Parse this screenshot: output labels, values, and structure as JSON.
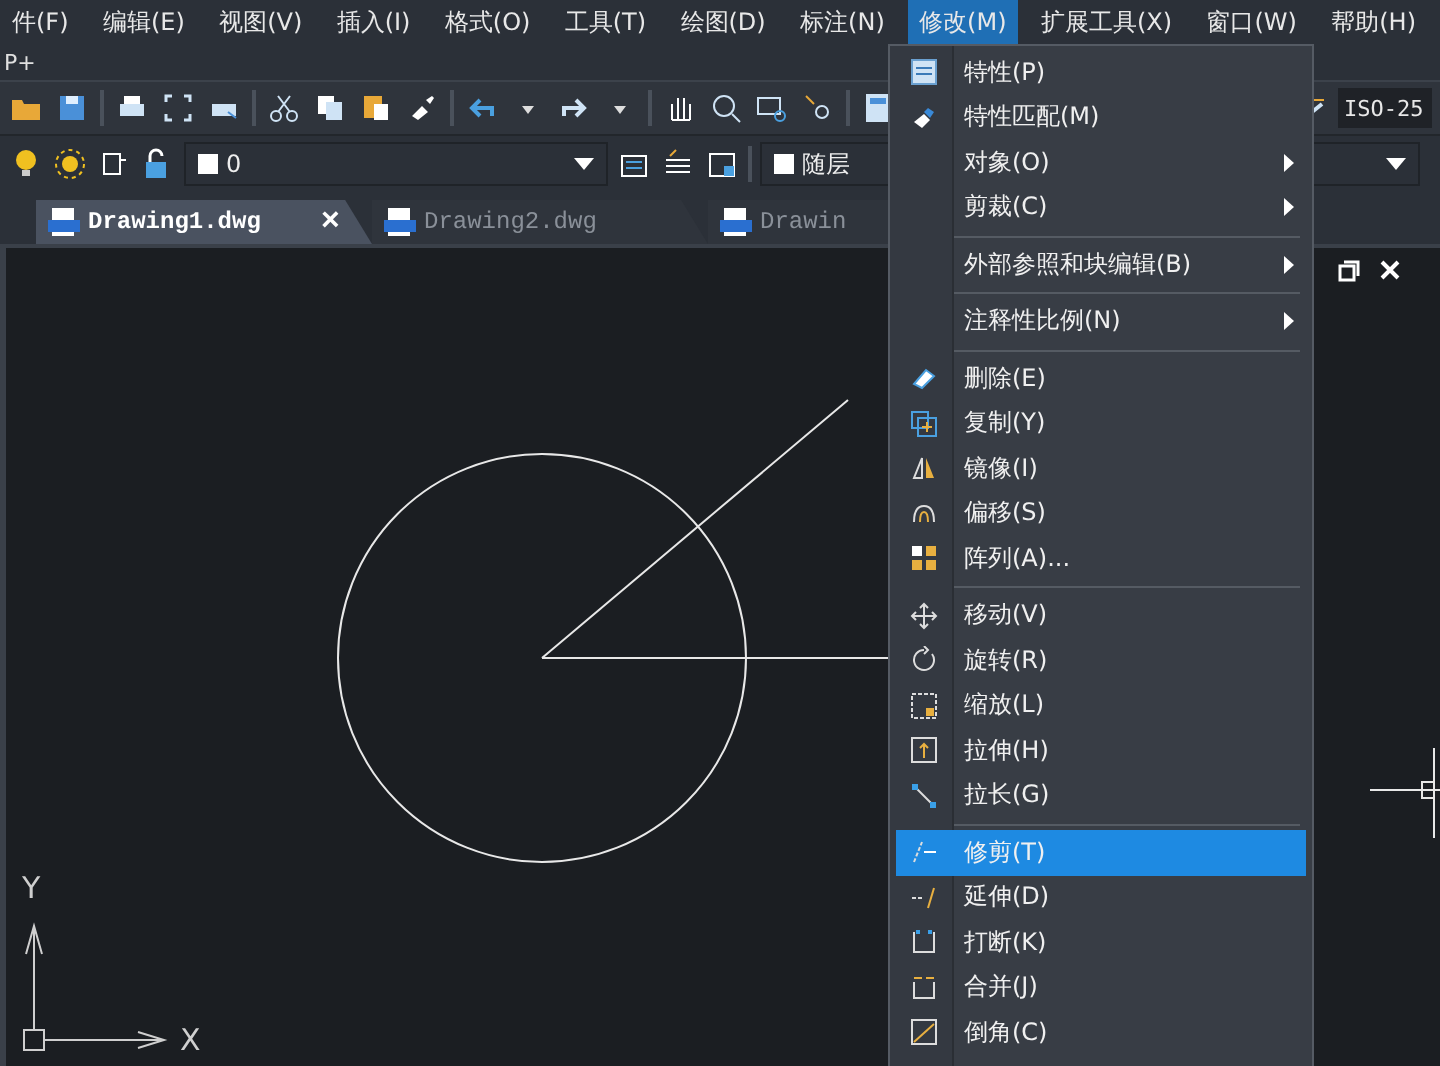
{
  "menubar": [
    {
      "label": "件(F)",
      "selected": false
    },
    {
      "label": "编辑(E)",
      "selected": false
    },
    {
      "label": "视图(V)",
      "selected": false
    },
    {
      "label": "插入(I)",
      "selected": false
    },
    {
      "label": "格式(O)",
      "selected": false
    },
    {
      "label": "工具(T)",
      "selected": false
    },
    {
      "label": "绘图(D)",
      "selected": false
    },
    {
      "label": "标注(N)",
      "selected": false
    },
    {
      "label": "修改(M)",
      "selected": true
    },
    {
      "label": "扩展工具(X)",
      "selected": false
    },
    {
      "label": "窗口(W)",
      "selected": false
    },
    {
      "label": "帮助(H)",
      "selected": false
    }
  ],
  "command_hint": "P+",
  "toolbar": {
    "dimension_style": "ISO-25"
  },
  "layer_bar": {
    "layer": "0",
    "color_setting": "随层"
  },
  "tabs": [
    {
      "label": "Drawing1.dwg",
      "selected": true,
      "close": "×"
    },
    {
      "label": "Drawing2.dwg",
      "selected": false
    },
    {
      "label": "Drawin",
      "selected": false
    }
  ],
  "axes": {
    "x": "X",
    "y": "Y"
  },
  "menu": {
    "items": [
      {
        "kind": "item",
        "label": "特性(P)",
        "submenu": false,
        "selected": false
      },
      {
        "kind": "item",
        "label": "特性匹配(M)",
        "submenu": false,
        "selected": false
      },
      {
        "kind": "item",
        "label": "对象(O)",
        "submenu": true,
        "selected": false
      },
      {
        "kind": "item",
        "label": "剪裁(C)",
        "submenu": true,
        "selected": false
      },
      {
        "kind": "separator"
      },
      {
        "kind": "item",
        "label": "外部参照和块编辑(B)",
        "submenu": true,
        "selected": false
      },
      {
        "kind": "separator"
      },
      {
        "kind": "item",
        "label": "注释性比例(N)",
        "submenu": true,
        "selected": false
      },
      {
        "kind": "separator"
      },
      {
        "kind": "item",
        "label": "删除(E)",
        "submenu": false,
        "selected": false
      },
      {
        "kind": "item",
        "label": "复制(Y)",
        "submenu": false,
        "selected": false
      },
      {
        "kind": "item",
        "label": "镜像(I)",
        "submenu": false,
        "selected": false
      },
      {
        "kind": "item",
        "label": "偏移(S)",
        "submenu": false,
        "selected": false
      },
      {
        "kind": "item",
        "label": "阵列(A)...",
        "submenu": false,
        "selected": false
      },
      {
        "kind": "separator"
      },
      {
        "kind": "item",
        "label": "移动(V)",
        "submenu": false,
        "selected": false
      },
      {
        "kind": "item",
        "label": "旋转(R)",
        "submenu": false,
        "selected": false
      },
      {
        "kind": "item",
        "label": "缩放(L)",
        "submenu": false,
        "selected": false
      },
      {
        "kind": "item",
        "label": "拉伸(H)",
        "submenu": false,
        "selected": false
      },
      {
        "kind": "item",
        "label": "拉长(G)",
        "submenu": false,
        "selected": false
      },
      {
        "kind": "separator"
      },
      {
        "kind": "item",
        "label": "修剪(T)",
        "submenu": false,
        "selected": true
      },
      {
        "kind": "item",
        "label": "延伸(D)",
        "submenu": false,
        "selected": false
      },
      {
        "kind": "item",
        "label": "打断(K)",
        "submenu": false,
        "selected": false
      },
      {
        "kind": "item",
        "label": "合并(J)",
        "submenu": false,
        "selected": false
      },
      {
        "kind": "item",
        "label": "倒角(C)",
        "submenu": false,
        "selected": false
      }
    ]
  }
}
